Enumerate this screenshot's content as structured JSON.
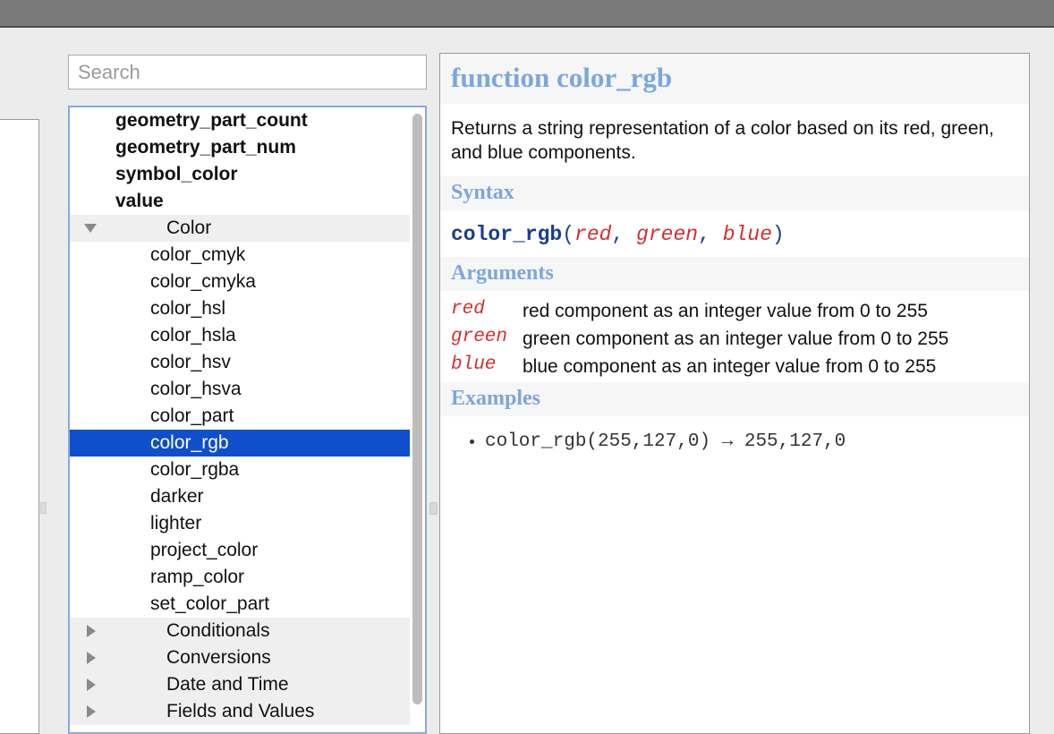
{
  "window": {
    "titlebar_color": "#7a7a7a",
    "background_color": "#ececec"
  },
  "search": {
    "placeholder": "Search",
    "value": ""
  },
  "tree": {
    "selection_color": "#0f4fcc",
    "rows": [
      {
        "label": "geometry_part_count",
        "kind": "leaf-bold",
        "selected": false,
        "twisty": "none"
      },
      {
        "label": "geometry_part_num",
        "kind": "leaf-bold",
        "selected": false,
        "twisty": "none"
      },
      {
        "label": "symbol_color",
        "kind": "leaf-bold",
        "selected": false,
        "twisty": "none"
      },
      {
        "label": "value",
        "kind": "leaf-bold",
        "selected": false,
        "twisty": "none"
      },
      {
        "label": "Color",
        "kind": "group",
        "selected": false,
        "twisty": "open"
      },
      {
        "label": "color_cmyk",
        "kind": "child",
        "selected": false,
        "twisty": "none"
      },
      {
        "label": "color_cmyka",
        "kind": "child",
        "selected": false,
        "twisty": "none"
      },
      {
        "label": "color_hsl",
        "kind": "child",
        "selected": false,
        "twisty": "none"
      },
      {
        "label": "color_hsla",
        "kind": "child",
        "selected": false,
        "twisty": "none"
      },
      {
        "label": "color_hsv",
        "kind": "child",
        "selected": false,
        "twisty": "none"
      },
      {
        "label": "color_hsva",
        "kind": "child",
        "selected": false,
        "twisty": "none"
      },
      {
        "label": "color_part",
        "kind": "child",
        "selected": false,
        "twisty": "none"
      },
      {
        "label": "color_rgb",
        "kind": "child",
        "selected": true,
        "twisty": "none"
      },
      {
        "label": "color_rgba",
        "kind": "child",
        "selected": false,
        "twisty": "none"
      },
      {
        "label": "darker",
        "kind": "child",
        "selected": false,
        "twisty": "none"
      },
      {
        "label": "lighter",
        "kind": "child",
        "selected": false,
        "twisty": "none"
      },
      {
        "label": "project_color",
        "kind": "child",
        "selected": false,
        "twisty": "none"
      },
      {
        "label": "ramp_color",
        "kind": "child",
        "selected": false,
        "twisty": "none"
      },
      {
        "label": "set_color_part",
        "kind": "child",
        "selected": false,
        "twisty": "none"
      },
      {
        "label": "Conditionals",
        "kind": "group",
        "selected": false,
        "twisty": "closed"
      },
      {
        "label": "Conversions",
        "kind": "group",
        "selected": false,
        "twisty": "closed"
      },
      {
        "label": "Date and Time",
        "kind": "group",
        "selected": false,
        "twisty": "closed"
      },
      {
        "label": "Fields and Values",
        "kind": "group",
        "selected": false,
        "twisty": "closed"
      }
    ]
  },
  "doc": {
    "title": "function color_rgb",
    "description": "Returns a string representation of a color based on its red, green, and blue components.",
    "syntax_heading": "Syntax",
    "syntax": {
      "function": "color_rgb",
      "open_paren": "(",
      "args": [
        "red",
        "green",
        "blue"
      ],
      "separator": ", ",
      "close_paren": ")"
    },
    "arguments_heading": "Arguments",
    "arguments": [
      {
        "name": "red",
        "description": "red component as an integer value from 0 to 255"
      },
      {
        "name": "green",
        "description": "green component as an integer value from 0 to 255"
      },
      {
        "name": "blue",
        "description": "blue component as an integer value from 0 to 255"
      }
    ],
    "examples_heading": "Examples",
    "examples": [
      "color_rgb(255,127,0) → 255,127,0"
    ]
  }
}
